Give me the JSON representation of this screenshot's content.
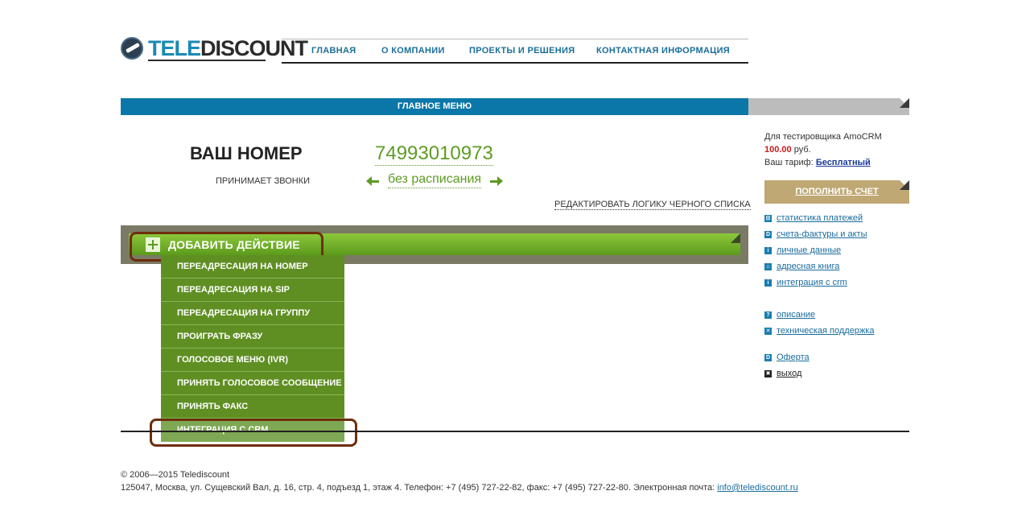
{
  "logo": {
    "part1": "TELE",
    "part2": "DISCOUNT"
  },
  "nav": [
    {
      "label": "ГЛАВНАЯ"
    },
    {
      "label": "О КОМПАНИИ"
    },
    {
      "label": "ПРОЕКТЫ И РЕШЕНИЯ"
    },
    {
      "label": "КОНТАКТНАЯ ИНФОРМАЦИЯ"
    }
  ],
  "menubar": {
    "title": "ГЛАВНОЕ МЕНЮ"
  },
  "number_section": {
    "your_number_label": "ВАШ НОМЕР",
    "accepts_calls_label": "ПРИНИМАЕТ ЗВОНКИ",
    "phone": "74993010973",
    "schedule": "без расписания",
    "edit_blacklist_link": "РЕДАКТИРОВАТЬ ЛОГИКУ ЧЕРНОГО СПИСКА"
  },
  "actions": {
    "add_action_label": "ДОБАВИТЬ ДЕЙСТВИЕ",
    "items": [
      {
        "label": "ПЕРЕАДРЕСАЦИЯ НА НОМЕР"
      },
      {
        "label": "ПЕРЕАДРЕСАЦИЯ НА SIP"
      },
      {
        "label": "ПЕРЕАДРЕСАЦИЯ НА ГРУППУ"
      },
      {
        "label": "ПРОИГРАТЬ ФРАЗУ"
      },
      {
        "label": "ГОЛОСОВОЕ МЕНЮ (IVR)"
      },
      {
        "label": "ПРИНЯТЬ ГОЛОСОВОЕ СООБЩЕНИЕ"
      },
      {
        "label": "ПРИНЯТЬ ФАКС"
      },
      {
        "label": "ИНТЕГРАЦИЯ С CRM"
      }
    ]
  },
  "account": {
    "user_line": "Для тестировщика AmoCRM",
    "balance": "100.00",
    "currency": "руб.",
    "tariff_label": "Ваш тариф:",
    "tariff_value": "Бесплатный",
    "topup_button": "ПОПОЛНИТЬ СЧЕТ"
  },
  "side_links": [
    {
      "icon": "grid-icon",
      "glyph": "⊞",
      "label": "статистика платежей"
    },
    {
      "icon": "document-icon",
      "glyph": "D",
      "label": "счета-фактуры и акты"
    },
    {
      "icon": "info-icon",
      "glyph": "i",
      "label": "личные данные"
    },
    {
      "icon": "home-icon",
      "glyph": "⌂",
      "label": "адресная книга"
    },
    {
      "icon": "info-icon",
      "glyph": "i",
      "label": "интеграция с crm"
    },
    {
      "icon": "help-icon",
      "glyph": "?",
      "label": "описание"
    },
    {
      "icon": "wrench-icon",
      "glyph": "✕",
      "label": "техническая поддержка"
    },
    {
      "icon": "document-icon",
      "glyph": "D",
      "label": "Оферта"
    },
    {
      "icon": "close-icon",
      "glyph": "✖",
      "label": "выход"
    }
  ],
  "footer": {
    "copyright": "© 2006—2015 Telediscount",
    "address": "125047, Москва, ул. Сущевский Вал, д. 16, стр. 4, подъезд 1, этаж 4. Телефон: +7 (495) 727-22-82, факс: +7 (495) 727-22-80. Электронная почта: ",
    "email": "info@telediscount.ru"
  }
}
